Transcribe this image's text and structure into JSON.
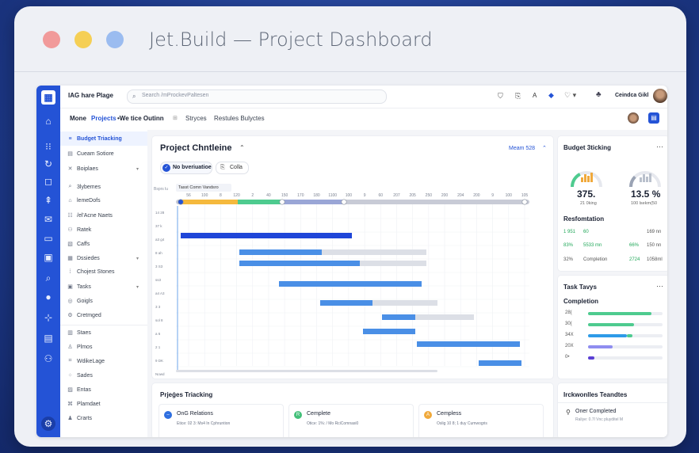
{
  "window": {
    "title": "Jet.Build — Project Dashboard"
  },
  "app": {
    "brand": "ІAG hare Plage",
    "search_placeholder": "Search /mProckevPaltesen",
    "user_name": "Ceindca Gikl",
    "subnav": {
      "left": "Mone",
      "active": "Projects",
      "item2": "•We tice Outinn",
      "item3": "Stryces",
      "item4": "Restules Bulyctes"
    }
  },
  "sidebar": {
    "items": [
      {
        "label": "Budget Triacking",
        "icon": "filter-icon",
        "active": true
      },
      {
        "label": "Cueam Sotiore",
        "icon": "document-icon"
      },
      {
        "label": "Boiplaes",
        "icon": "cross-icon",
        "chevron": true
      },
      {
        "label": "3lybemes",
        "icon": "search-icon"
      },
      {
        "label": "lemeDofs",
        "icon": "home-icon"
      },
      {
        "label": "/el'Acne Naets",
        "icon": "list-icon"
      },
      {
        "label": "Ratek",
        "icon": "people-icon"
      },
      {
        "label": "Caffs",
        "icon": "doc-icon"
      },
      {
        "label": "Dssiedes",
        "icon": "calendar-icon",
        "chevron": true
      },
      {
        "label": "Chojest Stones",
        "icon": "grid-icon"
      },
      {
        "label": "Tasks",
        "icon": "clipboard-icon",
        "chevron": true
      },
      {
        "label": "Goigls",
        "icon": "target-icon"
      },
      {
        "label": "Cretmged",
        "icon": "settings-icon"
      },
      {
        "label": "Staes",
        "icon": "chart-icon"
      },
      {
        "label": "Plmos",
        "icon": "user-icon"
      },
      {
        "label": "WdikeLage",
        "icon": "tag-icon"
      },
      {
        "label": "Sades",
        "icon": "dots-icon"
      },
      {
        "label": "Entas",
        "icon": "file-icon"
      },
      {
        "label": "Plamdaet",
        "icon": "link-icon"
      },
      {
        "label": "Crarts",
        "icon": "person-icon"
      }
    ]
  },
  "gantt": {
    "title": "Project Chntleine",
    "meam": "Meam 528",
    "chip_active": "No bveriuatioe",
    "chip_other": "Colla",
    "label_col": "Bsprs lu",
    "tooltip": "Tasst Comn Vandsro",
    "ticks": [
      "56",
      "100",
      "8",
      "120",
      "2",
      "40",
      "150",
      "170",
      "180",
      "1100",
      "100",
      "9",
      "60",
      "207",
      "205",
      "250",
      "200",
      "204",
      "200",
      "9",
      "100",
      "105"
    ],
    "row_labels": [
      "14 28",
      "37 k",
      "a3 g4",
      "8 ah",
      "3 S3",
      "ss3",
      "a4 A3",
      "3 3",
      "sol 8",
      "a 6",
      "2 1",
      "9 DK",
      "Nowd"
    ]
  },
  "budget": {
    "title": "Budget 3ticking",
    "gauge1_value": "375.",
    "gauge1_label": "21 0king",
    "gauge1_fraction": 0.35,
    "gauge2_value": "13.5 %",
    "gauge2_label": "100 lsekm(50",
    "gauge2_fraction": 0.25,
    "resformation": "Resfomtation",
    "rows": [
      {
        "a": "1 951",
        "b": "60",
        "c": "",
        "d": "169 nn"
      },
      {
        "a": "83%",
        "b": "5533 mn",
        "c": "66%",
        "d": "150 nn"
      },
      {
        "a": "32%",
        "b": "Completion",
        "c": "2724",
        "d": "1058ml"
      }
    ]
  },
  "tasks": {
    "title": "Task Tavys",
    "subtitle": "Completion",
    "rows": [
      {
        "label": "28(",
        "fraction": 0.85,
        "color": "#4ecb8f"
      },
      {
        "label": "30(",
        "fraction": 0.62,
        "color": "#4ecb8f"
      },
      {
        "label": "34X",
        "fraction": 0.52,
        "color": "#2f9be8",
        "second": 0.08
      },
      {
        "label": "20X",
        "fraction": 0.33,
        "color": "#8f8df0"
      },
      {
        "label": "0•",
        "fraction": 0.08,
        "color": "#5a3fd4"
      }
    ]
  },
  "progress": {
    "title": "Prjeǵes Triacking",
    "items": [
      {
        "title": "OnG Relations",
        "sub": "Etice: 02 3: Ms4 In Cphruntion",
        "icon": "minus-circle-icon",
        "color": "#2f6fe0",
        "letter": "–"
      },
      {
        "title": "Cemplete",
        "sub": "Otice: 1%: / Mo RciComnasi0",
        "icon": "r-circle-icon",
        "color": "#44c07a",
        "letter": "R"
      },
      {
        "title": "Cempless",
        "sub": "Oslig 10 8; 1 duy Cumwogris",
        "icon": "a-circle-icon",
        "color": "#f0a93b",
        "letter": "A"
      }
    ]
  },
  "teams": {
    "title": "Irckwonlles Teandtes",
    "item": "Oner Completed",
    "sub": "Raliye: 0.7l Vnc pluyditel M"
  }
}
